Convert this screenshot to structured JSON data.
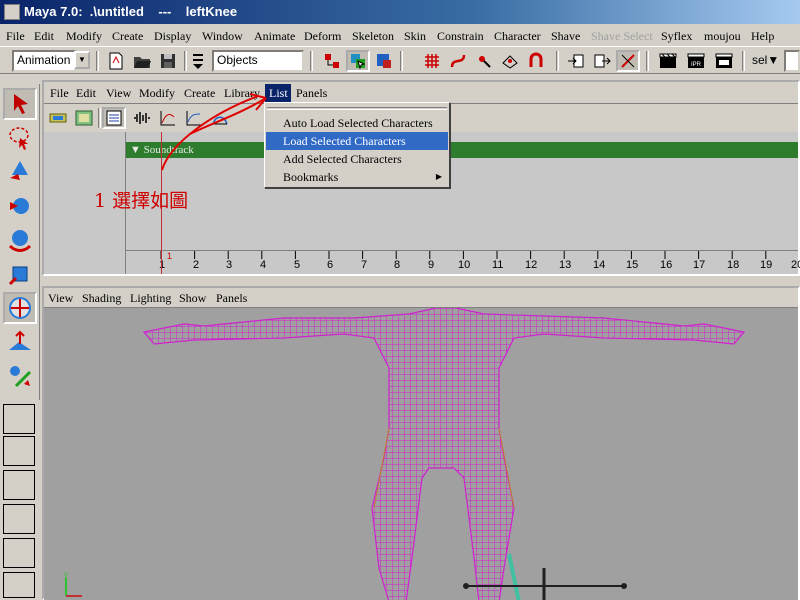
{
  "window": {
    "title": "Maya 7.0:  .\\untitled    ---    leftKnee"
  },
  "menubar": [
    "File",
    "Edit",
    "Modify",
    "Create",
    "Display",
    "Window",
    "Animate",
    "Deform",
    "Skeleton",
    "Skin",
    "Constrain",
    "Character",
    "Shave",
    "Shave Select",
    "Syflex",
    "moujou",
    "Help"
  ],
  "toolbar": {
    "mode": "Animation",
    "selection_field": "Objects",
    "sel_label": "sel"
  },
  "trax": {
    "menu": [
      "File",
      "Edit",
      "View",
      "Modify",
      "Create",
      "Library",
      "List",
      "Panels"
    ],
    "track_label": "Soundtrack",
    "current_frame": "1",
    "ruler": [
      "1",
      "2",
      "3",
      "4",
      "5",
      "6",
      "7",
      "8",
      "9",
      "10",
      "11",
      "12",
      "13",
      "14",
      "15",
      "16",
      "17",
      "18",
      "19",
      "20"
    ]
  },
  "list_menu": {
    "items": [
      "Auto Load Selected Characters",
      "Load Selected Characters",
      "Add Selected Characters",
      "Bookmarks"
    ],
    "highlighted": "Load Selected Characters"
  },
  "annotation": "1  選擇如圖",
  "viewport": {
    "menu": [
      "View",
      "Shading",
      "Lighting",
      "Show",
      "Panels"
    ]
  },
  "colors": {
    "title_gradient_start": "#0a246a",
    "menu_highlight": "#316ac5",
    "wireframe": "#d020d0",
    "soundtrack": "#2e7d2e",
    "annotation": "#d00000"
  }
}
